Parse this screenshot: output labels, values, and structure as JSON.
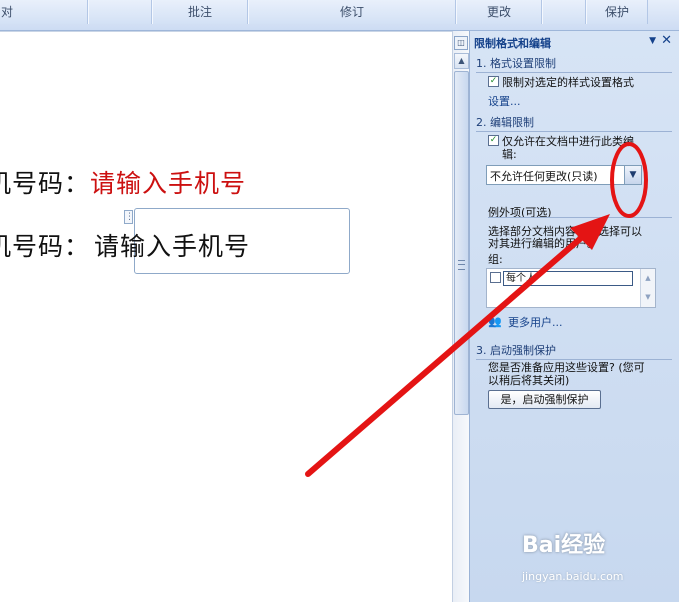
{
  "ribbon": {
    "groups": [
      "对",
      "批注",
      "修订",
      "更改",
      "保护"
    ]
  },
  "document": {
    "line1_label": "机号码：",
    "line1_placeholder": "请输入手机号",
    "line2_label": "机号码：",
    "line2_placeholder": "请输入手机号"
  },
  "task_pane": {
    "title": "限制格式和编辑",
    "section1": {
      "heading": "1. 格式设置限制",
      "checkbox_label": "限制对选定的样式设置格式",
      "link": "设置...",
      "checked": true
    },
    "section2": {
      "heading": "2. 编辑限制",
      "checkbox_line1": "仅允许在文档中进行此类编",
      "checkbox_line2": "辑:",
      "checked": true,
      "dropdown_value": "不允许任何更改(只读)",
      "exceptions_heading": "例外项(可选)",
      "exceptions_desc_line1": "选择部分文档内容，并选择可以",
      "exceptions_desc_line2": "对其进行编辑的用户。",
      "groups_label": "组:",
      "group_item": "每个人",
      "more_users": "更多用户..."
    },
    "section3": {
      "heading": "3. 启动强制保护",
      "desc_line1": "您是否准备应用这些设置? (您可",
      "desc_line2": "以稍后将其关闭)",
      "button": "是，启动强制保护"
    }
  },
  "watermark": {
    "brand": "Bai经验",
    "url": "jingyan.baidu.com"
  },
  "colors": {
    "annotation_red": "#e41414",
    "pane_bg": "#d2e0f3",
    "ribbon_bg": "#d6e3f5",
    "doc_red_text": "#cc1010"
  }
}
